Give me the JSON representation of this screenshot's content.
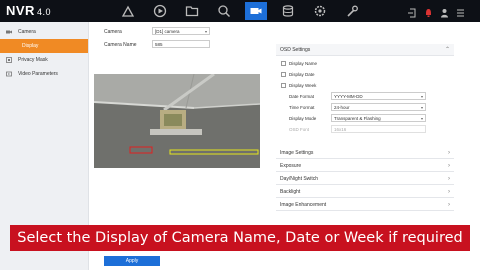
{
  "app": {
    "logo": "NVR",
    "version": "4.0"
  },
  "topnav": {
    "icons": [
      "live-view-icon",
      "playback-icon",
      "file-icon",
      "search-icon",
      "camera-icon",
      "storage-icon",
      "settings-icon",
      "maintenance-icon"
    ],
    "active": "camera-icon"
  },
  "sidebar": {
    "items": [
      {
        "label": "Camera",
        "icon": "camera-icon",
        "active": false,
        "sub": false
      },
      {
        "label": "Display",
        "icon": "",
        "active": true,
        "sub": true
      },
      {
        "label": "Privacy Mask",
        "icon": "privacy-icon",
        "active": false,
        "sub": false
      },
      {
        "label": "Video Parameters",
        "icon": "video-icon",
        "active": false,
        "sub": false
      }
    ]
  },
  "form": {
    "camera_label": "Camera",
    "camera_value": "[D1] camera",
    "camera_name_label": "Camera Name",
    "camera_name_value": "585"
  },
  "osd": {
    "title": "OSD Settings",
    "display_name": "Display Name",
    "display_date": "Display Date",
    "display_week": "Display Week",
    "date_format_label": "Date Format",
    "date_format_value": "YYYY-MM-DD",
    "time_format_label": "Time Format",
    "time_format_value": "24-hour",
    "display_mode_label": "Display Mode",
    "display_mode_value": "Transparent & Flashing",
    "osd_font_label": "OSD Font",
    "osd_font_value": "16x16"
  },
  "sections": [
    {
      "label": "Image Settings"
    },
    {
      "label": "Exposure"
    },
    {
      "label": "Day/Night Switch"
    },
    {
      "label": "Backlight"
    },
    {
      "label": "Image Enhancement"
    }
  ],
  "banner": {
    "text": "Select the Display of Camera Name, Date or Week if required"
  },
  "apply": {
    "label": "Apply"
  },
  "colors": {
    "accent": "#1d6fd8",
    "active_sidebar": "#f08a24",
    "banner": "#c8111f",
    "topbar": "#0d1016"
  }
}
